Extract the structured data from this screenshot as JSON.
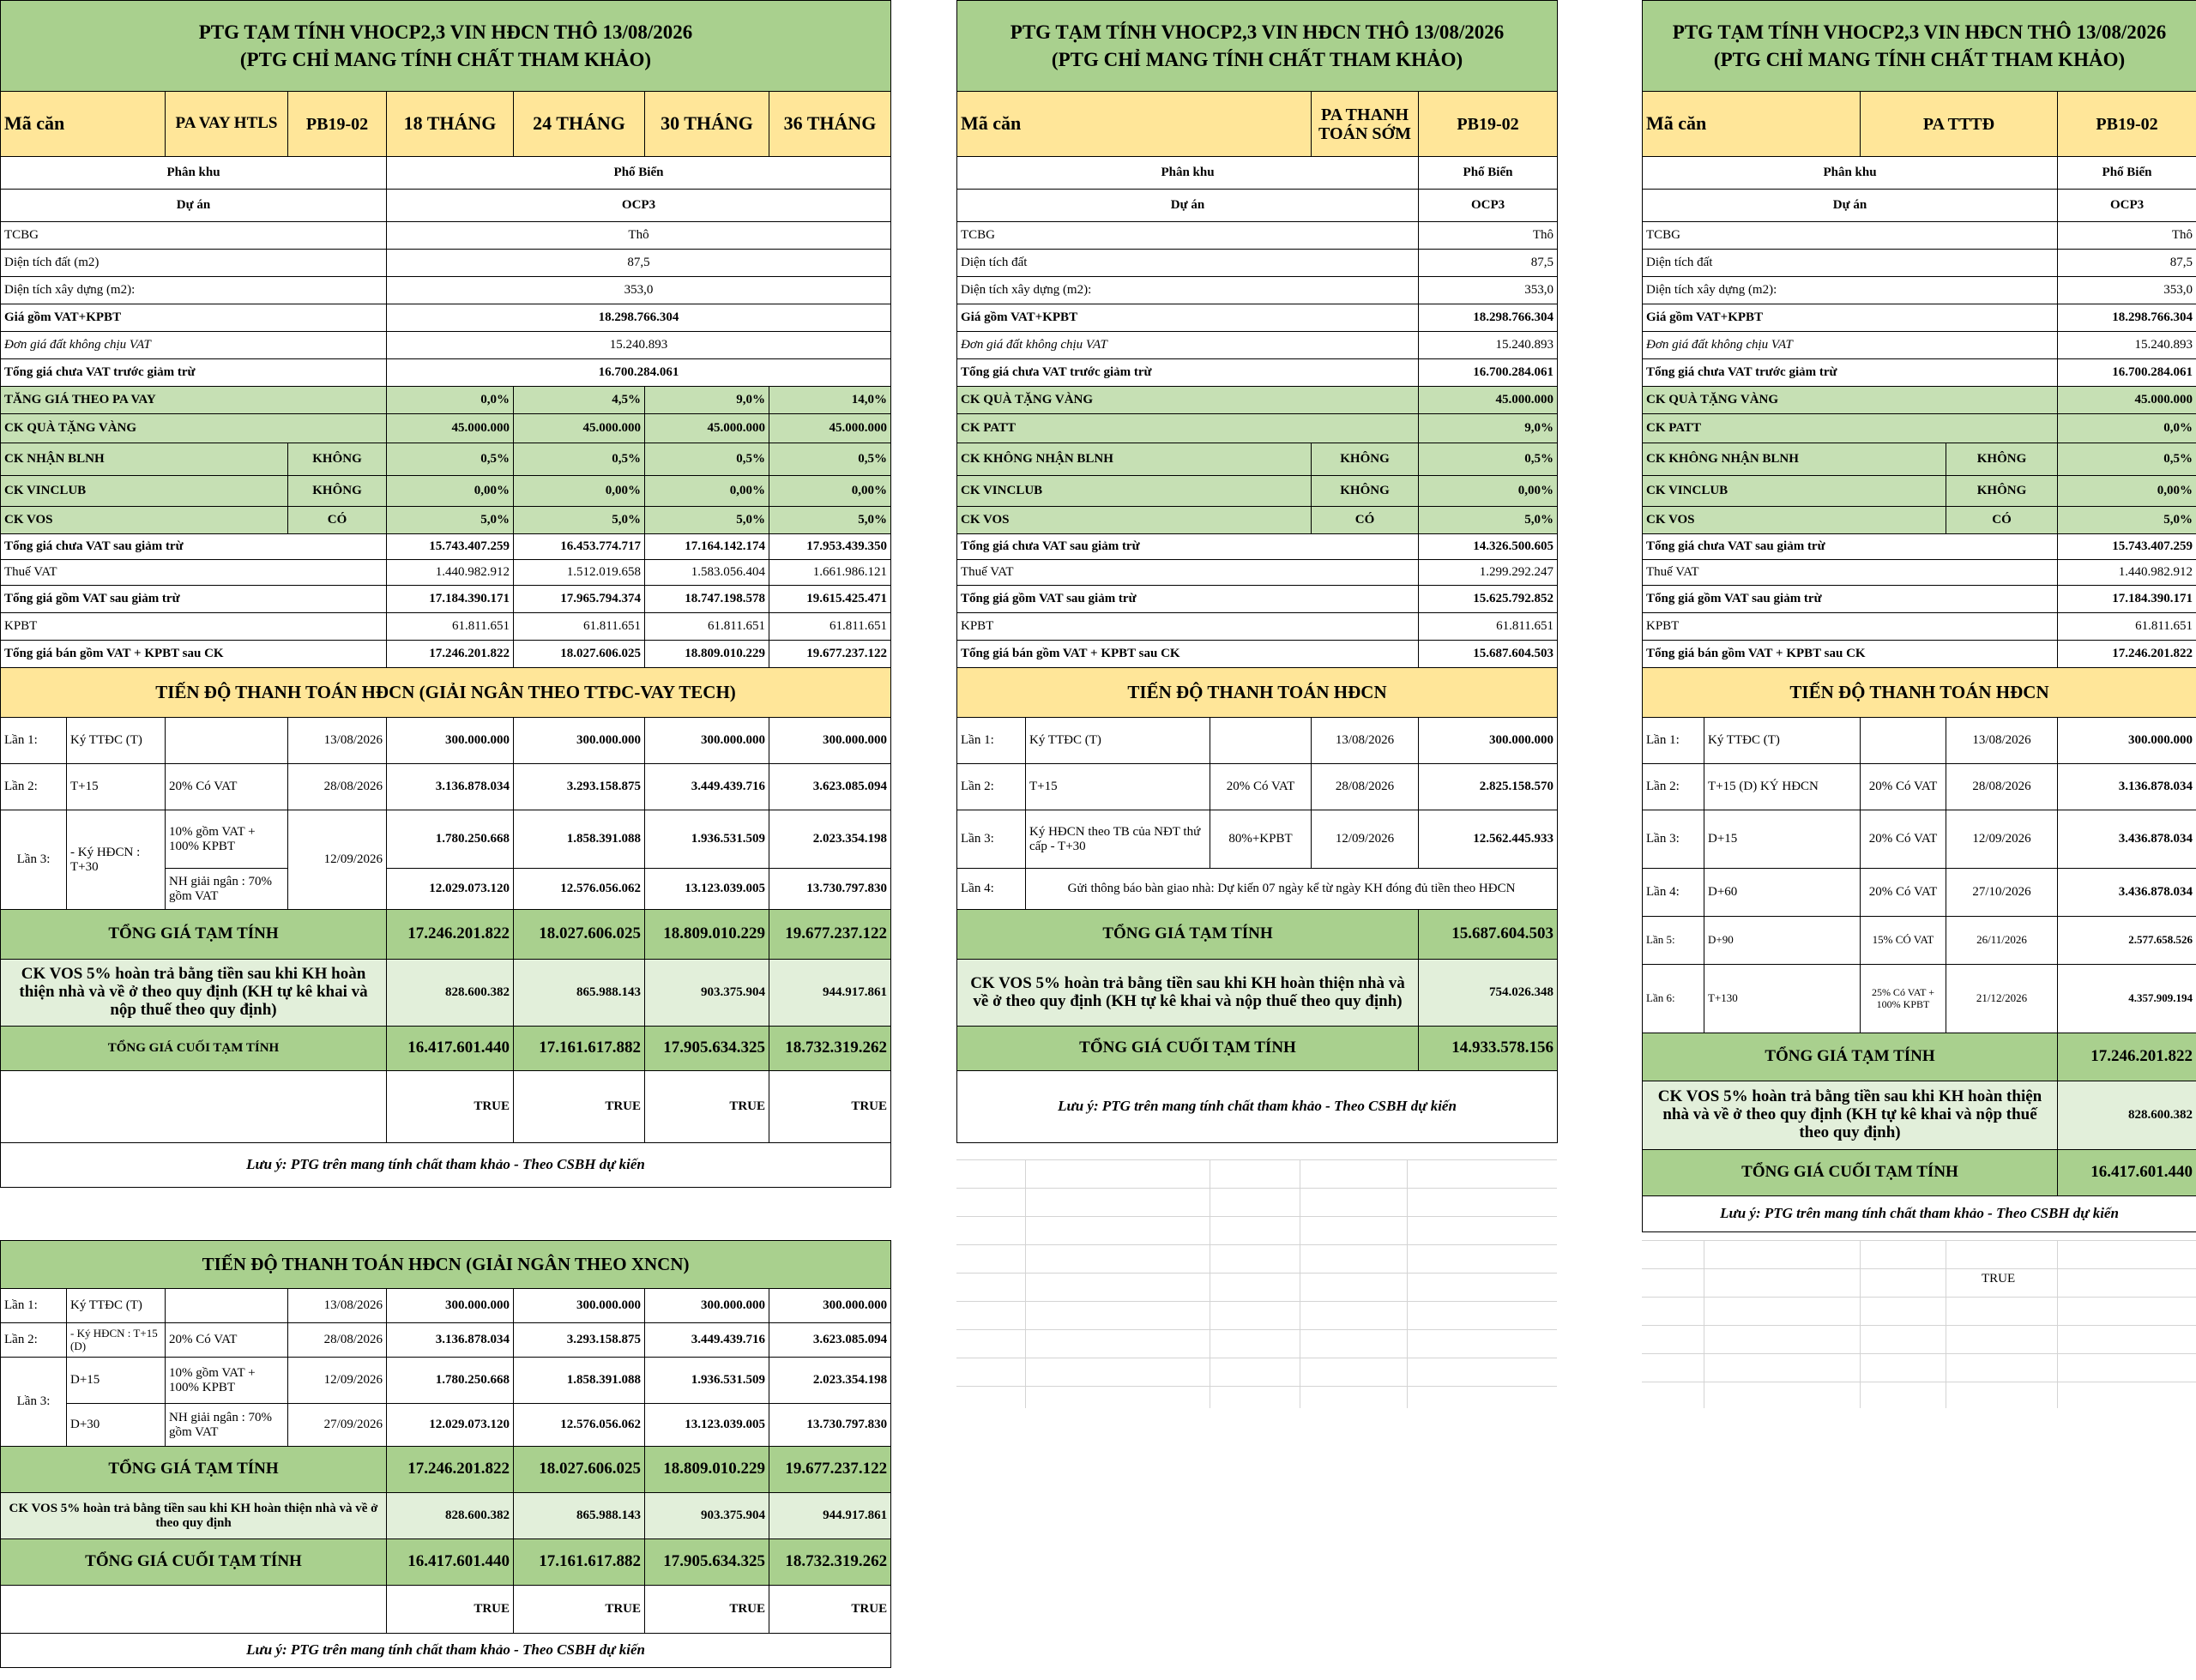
{
  "title_line1": "PTG TẠM TÍNH VHOCP2,3 VIN HĐCN THÔ 13/08/2026",
  "title_line2": "(PTG CHỈ MANG TÍNH CHẤT THAM KHẢO)",
  "common": {
    "ma_can": "Mã căn",
    "unit": "PB19-02",
    "phan_khu_label": "Phân khu",
    "phan_khu": "Phố Biển",
    "du_an_label": "Dự án",
    "du_an": "OCP3",
    "tcbg_label": "TCBG",
    "tcbg": "Thô",
    "dt_dat_label_a": "Diện tích đất (m2)",
    "dt_dat_label_b": "Diện tích đất",
    "dt_dat": "87,5",
    "dt_xd_label": "Diện tích xây dựng (m2):",
    "dt_xd": "353,0",
    "gia_vat_label": "Giá gồm VAT+KPBT",
    "gia_vat": "18.298.766.304",
    "don_gia_label": "Đơn giá đất không chịu VAT",
    "don_gia": "15.240.893",
    "tong_truoc_label": "Tổng giá chưa VAT trước giảm trừ",
    "tong_truoc": "16.700.284.061",
    "khong": "KHÔNG",
    "co": "CÓ",
    "true": "TRUE",
    "note": "Lưu ý: PTG trên mang tính chất tham khảo - Theo CSBH dự kiến",
    "tong_sau_label": "Tổng giá chưa VAT sau giảm trừ",
    "thue_label": "Thuế VAT",
    "tong_gom_label": "Tổng giá gồm VAT sau giảm trừ",
    "kpbt_label": "KPBT",
    "tong_ban_label": "Tổng giá bán gồm VAT + KPBT sau CK",
    "tong_tam_tinh": "TỔNG GIÁ TẠM TÍNH",
    "tong_cuoi": "TỔNG GIÁ CUỐI TẠM TÍNH",
    "vos_long": "CK VOS 5% hoàn trả bằng tiền sau khi KH hoàn thiện nhà và về ở theo quy định (KH tự kê khai và nộp thuế theo quy định)",
    "vos_short": "CK VOS 5% hoàn trả bằng tiền sau khi KH hoàn thiện nhà và về ở theo quy định",
    "lan1": "Lần 1:",
    "lan2": "Lần 2:",
    "lan3": "Lần 3:",
    "lan4": "Lần 4:",
    "lan5": "Lần 5:",
    "lan6": "Lần 6:",
    "ky_ttdc": "Ký TTĐC (T)",
    "d130826": "13/08/2026",
    "d280826": "28/08/2026",
    "d120926": "12/09/2026",
    "d270926": "27/09/2026",
    "d271026": "27/10/2026",
    "d261126": "26/11/2026",
    "d211226": "21/12/2026",
    "pct20": "20% Có VAT"
  },
  "t1": {
    "pa": "PA VAY HTLS",
    "terms": [
      "18 THÁNG",
      "24 THÁNG",
      "30 THÁNG",
      "36 THÁNG"
    ],
    "tang_gia_label": "TĂNG GIÁ THEO PA VAY",
    "tang_gia": [
      "0,0%",
      "4,5%",
      "9,0%",
      "14,0%"
    ],
    "ck_vang_label": "CK QUÀ TẶNG VÀNG",
    "ck_vang": [
      "45.000.000",
      "45.000.000",
      "45.000.000",
      "45.000.000"
    ],
    "ck_blnh_label": "CK NHẬN BLNH",
    "ck_blnh": [
      "0,5%",
      "0,5%",
      "0,5%",
      "0,5%"
    ],
    "ck_vinclub_label": "CK VINCLUB",
    "ck_vinclub": [
      "0,00%",
      "0,00%",
      "0,00%",
      "0,00%"
    ],
    "ck_vos_label": "CK VOS",
    "ck_vos": [
      "5,0%",
      "5,0%",
      "5,0%",
      "5,0%"
    ],
    "tong_sau": [
      "15.743.407.259",
      "16.453.774.717",
      "17.164.142.174",
      "17.953.439.350"
    ],
    "thue": [
      "1.440.982.912",
      "1.512.019.658",
      "1.583.056.404",
      "1.661.986.121"
    ],
    "tong_gom": [
      "17.184.390.171",
      "17.965.794.374",
      "18.747.198.578",
      "19.615.425.471"
    ],
    "kpbt": [
      "61.811.651",
      "61.811.651",
      "61.811.651",
      "61.811.651"
    ],
    "tong_ban": [
      "17.246.201.822",
      "18.027.606.025",
      "18.809.010.229",
      "19.677.237.122"
    ],
    "sched_title": "TIẾN ĐỘ THANH TOÁN HĐCN (GIẢI NGÂN THEO TTĐC-VAY TECH)",
    "l1": [
      "300.000.000",
      "300.000.000",
      "300.000.000",
      "300.000.000"
    ],
    "l2_label": "T+15",
    "l2": [
      "3.136.878.034",
      "3.293.158.875",
      "3.449.439.716",
      "3.623.085.094"
    ],
    "l3_label": "- Ký HĐCN : T+30",
    "l3a_note": "10% gồm VAT + 100% KPBT",
    "l3a": [
      "1.780.250.668",
      "1.858.391.088",
      "1.936.531.509",
      "2.023.354.198"
    ],
    "l3b_note": "NH giải ngân : 70% gồm VAT",
    "l3b": [
      "12.029.073.120",
      "12.576.056.062",
      "13.123.039.005",
      "13.730.797.830"
    ],
    "tong_tam": [
      "17.246.201.822",
      "18.027.606.025",
      "18.809.010.229",
      "19.677.237.122"
    ],
    "vos": [
      "828.600.382",
      "865.988.143",
      "903.375.904",
      "944.917.861"
    ],
    "cuoi": [
      "16.417.601.440",
      "17.161.617.882",
      "17.905.634.325",
      "18.732.319.262"
    ]
  },
  "t2": {
    "pa": "PA THANH TOÁN SỚM",
    "ck_vang_label": "CK QUÀ TẶNG VÀNG",
    "ck_vang": "45.000.000",
    "ck_patt_label": "CK PATT",
    "ck_patt": "9,0%",
    "ck_blnh_label": "CK KHÔNG NHẬN BLNH",
    "ck_blnh": "0,5%",
    "ck_vinclub_label": "CK VINCLUB",
    "ck_vinclub": "0,00%",
    "ck_vos_label": "CK VOS",
    "ck_vos": "5,0%",
    "tong_sau": "14.326.500.605",
    "thue": "1.299.292.247",
    "tong_gom": "15.625.792.852",
    "kpbt": "61.811.651",
    "tong_ban": "15.687.604.503",
    "sched_title": "TIẾN ĐỘ THANH TOÁN HĐCN",
    "l1": "300.000.000",
    "l2_label": "T+15",
    "l2": "2.825.158.570",
    "l3_label": "Ký HĐCN theo TB của NĐT thứ cấp - T+30",
    "l3_note": "80%+KPBT",
    "l3": "12.562.445.933",
    "l4_text": "Gửi thông báo bàn giao nhà: Dự kiến 07 ngày kể từ ngày KH đóng đủ tiền theo HĐCN",
    "tong_tam": "15.687.604.503",
    "vos": "754.026.348",
    "cuoi": "14.933.578.156"
  },
  "t3": {
    "pa": "PA TTTĐ",
    "ck_vang_label": "CK QUÀ TẶNG VÀNG",
    "ck_vang": "45.000.000",
    "ck_patt_label": "CK PATT",
    "ck_patt": "0,0%",
    "ck_blnh_label": "CK KHÔNG NHẬN BLNH",
    "ck_blnh": "0,5%",
    "ck_vinclub_label": "CK VINCLUB",
    "ck_vinclub": "0,00%",
    "ck_vos_label": "CK VOS",
    "ck_vos": "5,0%",
    "tong_sau": "15.743.407.259",
    "thue": "1.440.982.912",
    "tong_gom": "17.184.390.171",
    "kpbt": "61.811.651",
    "tong_ban": "17.246.201.822",
    "sched_title": "TIẾN ĐỘ THANH TOÁN HĐCN",
    "l1": "300.000.000",
    "l2_label": "T+15 (D) KÝ HĐCN",
    "l2": "3.136.878.034",
    "l3_label": "D+15",
    "l3": "3.436.878.034",
    "l4_label": "D+60",
    "l4": "3.436.878.034",
    "l5_label": "D+90",
    "l5_note": "15% CÓ VAT",
    "l5": "2.577.658.526",
    "l6_label": "T+130",
    "l6_note": "25% Có VAT + 100% KPBT",
    "l6": "4.357.909.194",
    "tong_tam": "17.246.201.822",
    "vos": "828.600.382",
    "cuoi": "16.417.601.440"
  },
  "t4": {
    "sched_title": "TIẾN ĐỘ THANH TOÁN HĐCN (GIẢI NGÂN THEO XNCN)",
    "l1": [
      "300.000.000",
      "300.000.000",
      "300.000.000",
      "300.000.000"
    ],
    "l2_label": "- Ký HĐCN : T+15 (D)",
    "l2": [
      "3.136.878.034",
      "3.293.158.875",
      "3.449.439.716",
      "3.623.085.094"
    ],
    "l3a_label": "D+15",
    "l3a_note": "10% gồm VAT + 100% KPBT",
    "l3a": [
      "1.780.250.668",
      "1.858.391.088",
      "1.936.531.509",
      "2.023.354.198"
    ],
    "l3b_label": "D+30",
    "l3b_note": "NH giải ngân : 70% gồm VAT",
    "l3b": [
      "12.029.073.120",
      "12.576.056.062",
      "13.123.039.005",
      "13.730.797.830"
    ],
    "tong_tam": [
      "17.246.201.822",
      "18.027.606.025",
      "18.809.010.229",
      "19.677.237.122"
    ],
    "vos": [
      "828.600.382",
      "865.988.143",
      "903.375.904",
      "944.917.861"
    ],
    "cuoi": [
      "16.417.601.440",
      "17.161.617.882",
      "17.905.634.325",
      "18.732.319.262"
    ]
  }
}
